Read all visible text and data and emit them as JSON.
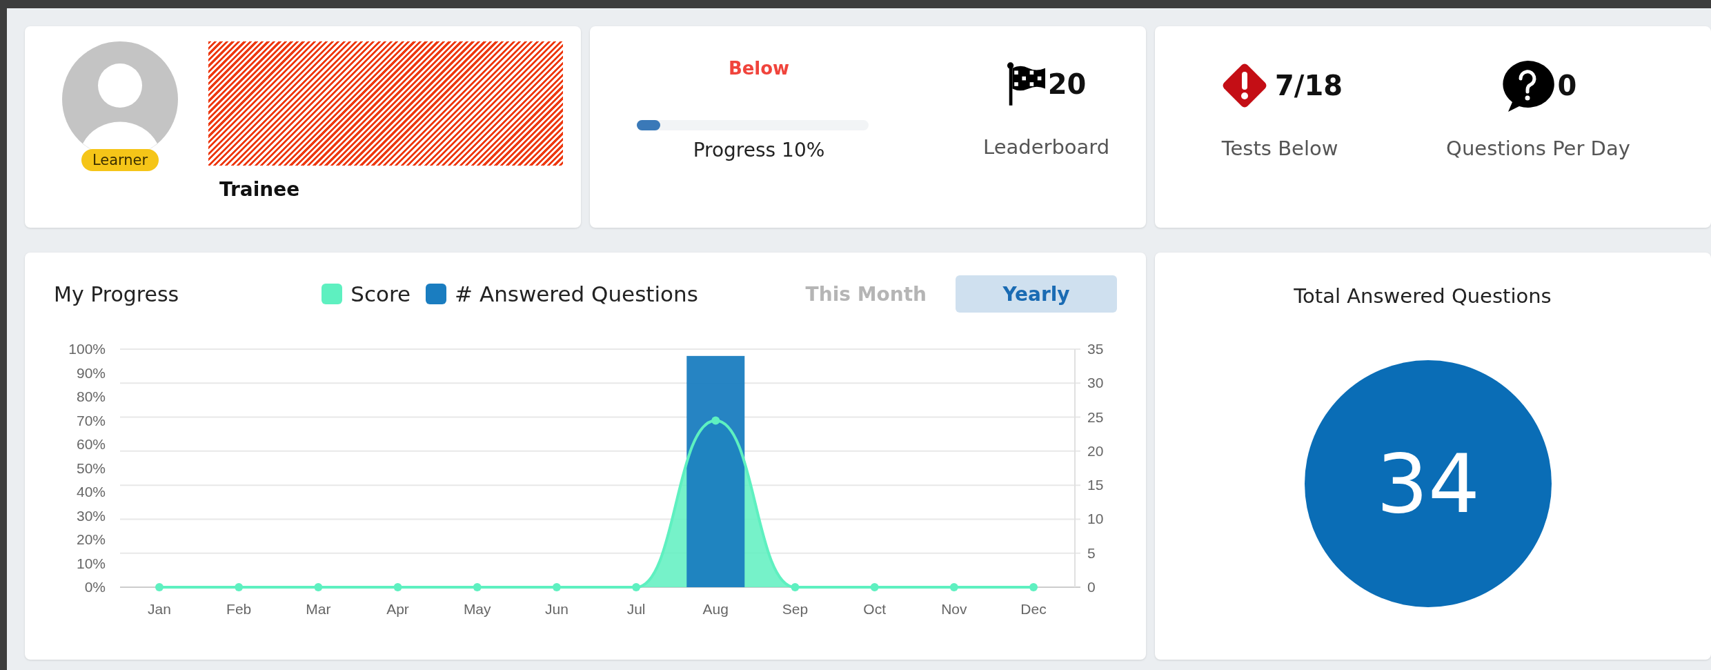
{
  "profile": {
    "badge": "Learner",
    "role": "Trainee"
  },
  "progress_card": {
    "status": "Below",
    "level": 0.1,
    "label": "Progress 10%",
    "leaderboard": {
      "value": "20",
      "label": "Leaderboard"
    }
  },
  "stats": [
    {
      "kind": "tests",
      "value": "7/18",
      "label": "Tests Below"
    },
    {
      "kind": "questions",
      "value": "0",
      "label": "Questions Per Day"
    }
  ],
  "my_progress": {
    "title": "My Progress",
    "ranges": [
      {
        "label": "This Month",
        "selected": false
      },
      {
        "label": "Yearly",
        "selected": true
      }
    ],
    "chart_data": {
      "type": "bar",
      "categories": [
        "Jan",
        "Feb",
        "Mar",
        "Apr",
        "May",
        "Jun",
        "Jul",
        "Aug",
        "Sep",
        "Oct",
        "Nov",
        "Dec"
      ],
      "series": [
        {
          "name": "Score",
          "color": "#5ef0c0",
          "type": "area",
          "values": [
            0,
            0,
            0,
            0,
            0,
            0,
            0,
            70,
            0,
            0,
            0,
            0
          ]
        },
        {
          "name": "# Answered Questions",
          "color": "#1a7dc0",
          "axis": "y2",
          "values": [
            null,
            null,
            null,
            null,
            null,
            null,
            null,
            34,
            null,
            null,
            null,
            null
          ]
        }
      ],
      "grid": true,
      "ylim": [
        0,
        100
      ],
      "yticks": [
        {
          "value": 0,
          "label": "0%"
        },
        {
          "value": 10,
          "label": "10%"
        },
        {
          "value": 20,
          "label": "20%"
        },
        {
          "value": 30,
          "label": "30%"
        },
        {
          "value": 40,
          "label": "40%"
        },
        {
          "value": 50,
          "label": "50%"
        },
        {
          "value": 60,
          "label": "60%"
        },
        {
          "value": 70,
          "label": "70%"
        },
        {
          "value": 80,
          "label": "80%"
        },
        {
          "value": 90,
          "label": "90%"
        },
        {
          "value": 100,
          "label": "100%"
        }
      ],
      "y2lim": [
        0,
        35
      ],
      "y2ticks": [
        0,
        5,
        10,
        15,
        20,
        25,
        30,
        35
      ]
    }
  },
  "total": {
    "title": "Total Answered Questions",
    "value": "34"
  }
}
